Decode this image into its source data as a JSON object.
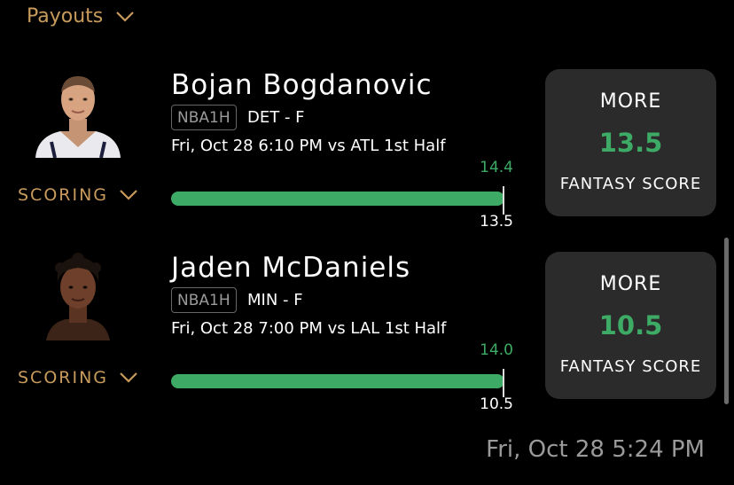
{
  "header": {
    "payouts_label": "Payouts"
  },
  "colors": {
    "accent": "#c89b5d",
    "green": "#3dab65",
    "card": "#2b2b2b",
    "muted": "#9a9a9a"
  },
  "icons": {
    "dropdown": "chevron-down-icon"
  },
  "players": [
    {
      "name": "Bojan Bogdanovic",
      "league_badge": "NBA1H",
      "team_pos": "DET - F",
      "game_info": "Fri, Oct 28 6:10 PM  vs ATL 1st Half",
      "stat_toggle": "SCORING",
      "actual": "14.4",
      "line": "13.5",
      "progress_fraction": 1.0,
      "pick": {
        "direction": "MORE",
        "line": "13.5",
        "stat": "FANTASY SCORE"
      }
    },
    {
      "name": "Jaden McDaniels",
      "league_badge": "NBA1H",
      "team_pos": "MIN - F",
      "game_info": "Fri, Oct 28 7:00 PM  vs LAL 1st Half",
      "stat_toggle": "SCORING",
      "actual": "14.0",
      "line": "10.5",
      "progress_fraction": 1.0,
      "pick": {
        "direction": "MORE",
        "line": "10.5",
        "stat": "FANTASY SCORE"
      }
    }
  ],
  "footer": {
    "timestamp": "Fri, Oct 28 5:24 PM"
  }
}
